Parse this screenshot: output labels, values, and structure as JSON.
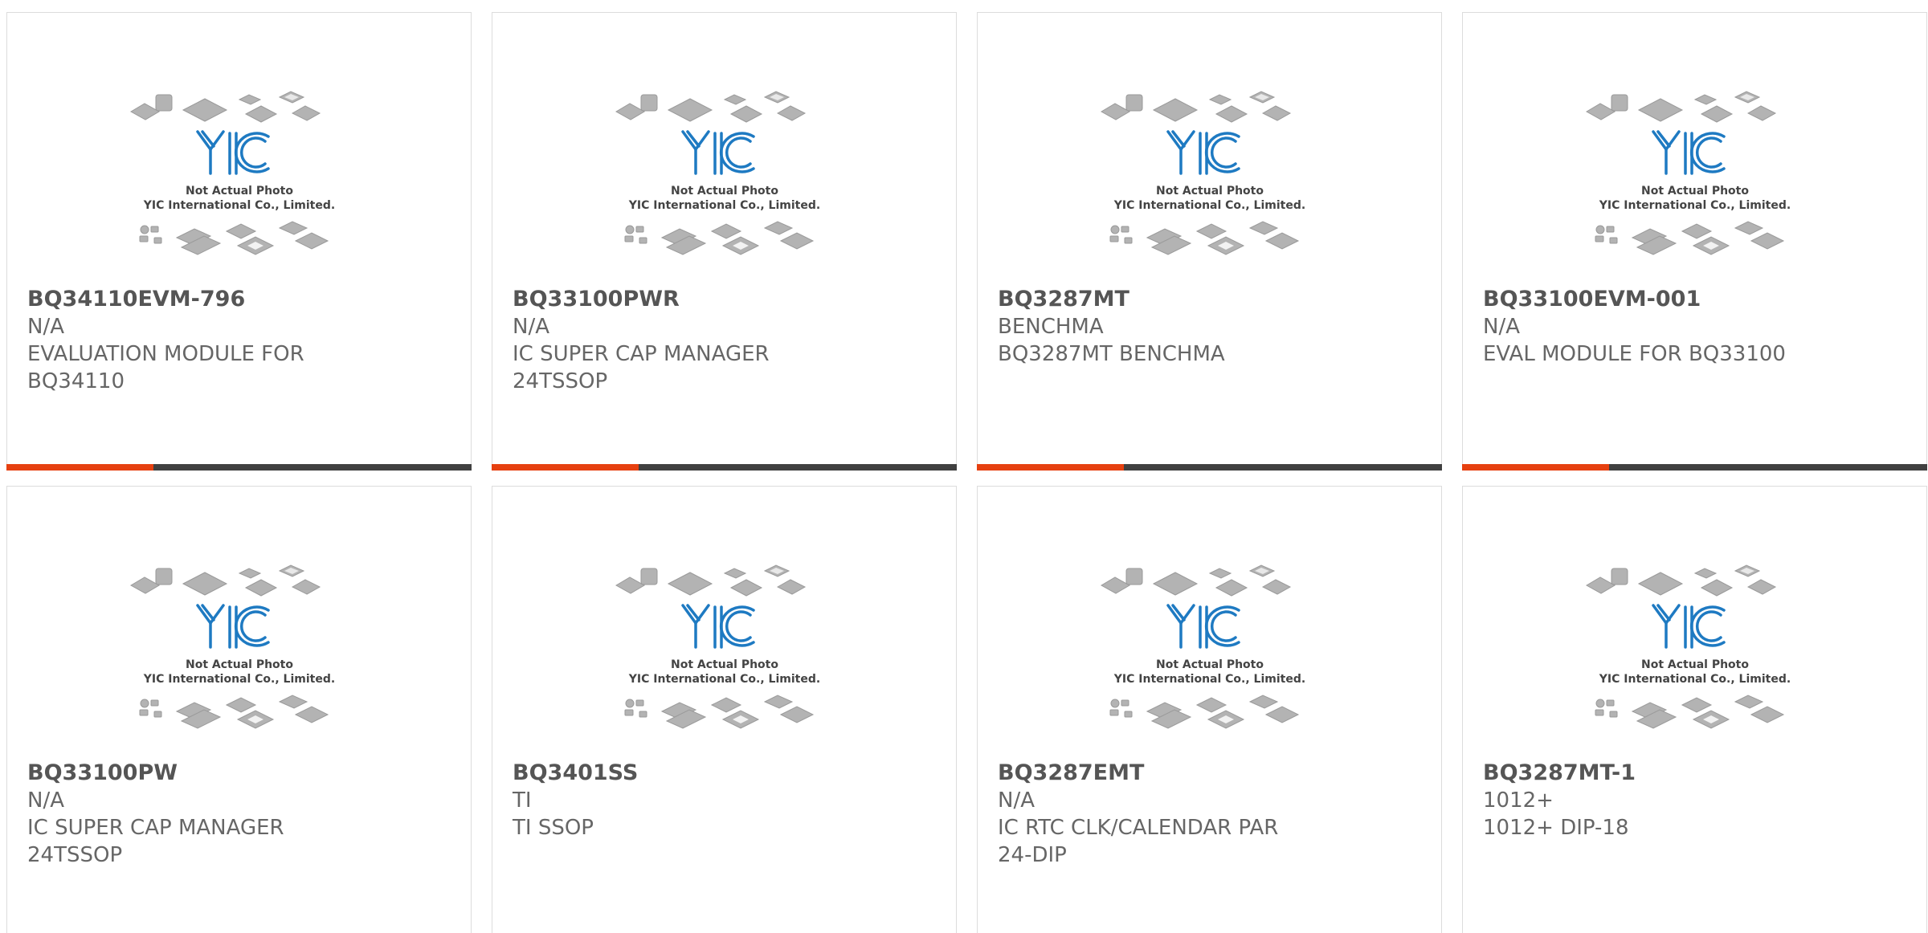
{
  "watermark": {
    "logo_text": "YIC",
    "line1": "Not Actual Photo",
    "line2": "YIC International Co., Limited."
  },
  "colors": {
    "accent": "#e64010",
    "bar": "#404040",
    "logo": "#1e7ac2"
  },
  "products": [
    {
      "part_number": "BQ34110EVM-796",
      "manufacturer": "N/A",
      "description": "EVALUATION MODULE FOR BQ34110"
    },
    {
      "part_number": "BQ33100PWR",
      "manufacturer": "N/A",
      "description": "IC SUPER CAP MANAGER 24TSSOP"
    },
    {
      "part_number": "BQ3287MT",
      "manufacturer": "BENCHMA",
      "description": "BQ3287MT BENCHMA"
    },
    {
      "part_number": "BQ33100EVM-001",
      "manufacturer": "N/A",
      "description": "EVAL MODULE FOR BQ33100"
    },
    {
      "part_number": "BQ33100PW",
      "manufacturer": "N/A",
      "description": "IC SUPER CAP MANAGER 24TSSOP"
    },
    {
      "part_number": "BQ3401SS",
      "manufacturer": "TI",
      "description": "TI SSOP"
    },
    {
      "part_number": "BQ3287EMT",
      "manufacturer": "N/A",
      "description": "IC RTC CLK/CALENDAR PAR 24-DIP"
    },
    {
      "part_number": "BQ3287MT-1",
      "manufacturer": "1012+",
      "description": "1012+ DIP-18"
    }
  ]
}
